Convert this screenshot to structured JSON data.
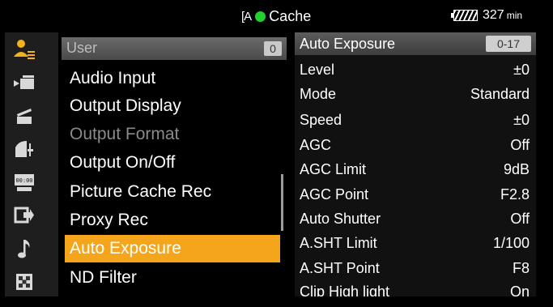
{
  "status": {
    "mode_icon_text": "[A",
    "cache_label": "Cache",
    "battery_minutes": "327",
    "battery_unit": "min",
    "colors": {
      "cache_dot": "#22d12e",
      "selection": "#f5a51c"
    }
  },
  "icons": [
    {
      "name": "user-icon",
      "glyph": "👤",
      "selected": true
    },
    {
      "name": "camera-icon",
      "glyph": "▶"
    },
    {
      "name": "clapper-icon",
      "glyph": "▲"
    },
    {
      "name": "paint-icon",
      "glyph": "◢"
    },
    {
      "name": "timecode-icon",
      "glyph": "⌚"
    },
    {
      "name": "output-icon",
      "glyph": "➜"
    },
    {
      "name": "music-note-icon",
      "glyph": "♪"
    },
    {
      "name": "grid-icon",
      "glyph": "▦"
    }
  ],
  "menu": {
    "header_title": "User",
    "header_badge": "0",
    "items": [
      {
        "label": "Audio Input"
      },
      {
        "label": "Output Display"
      },
      {
        "label": "Output Format",
        "disabled": true
      },
      {
        "label": "Output On/Off"
      },
      {
        "label": "Picture Cache Rec"
      },
      {
        "label": "Proxy Rec"
      },
      {
        "label": "Auto Exposure",
        "selected": true
      },
      {
        "label": "ND Filter"
      }
    ]
  },
  "panel": {
    "title": "Auto Exposure",
    "badge": "0-17",
    "rows": [
      {
        "label": "Level",
        "value": "±0"
      },
      {
        "label": "Mode",
        "value": "Standard"
      },
      {
        "label": "Speed",
        "value": "±0"
      },
      {
        "label": "AGC",
        "value": "Off"
      },
      {
        "label": "AGC Limit",
        "value": "9dB"
      },
      {
        "label": "AGC Point",
        "value": "F2.8"
      },
      {
        "label": "Auto Shutter",
        "value": "Off"
      },
      {
        "label": "A.SHT Limit",
        "value": "1/100"
      },
      {
        "label": "A.SHT Point",
        "value": "F8"
      },
      {
        "label": "Clip High light",
        "value": "On"
      }
    ]
  }
}
